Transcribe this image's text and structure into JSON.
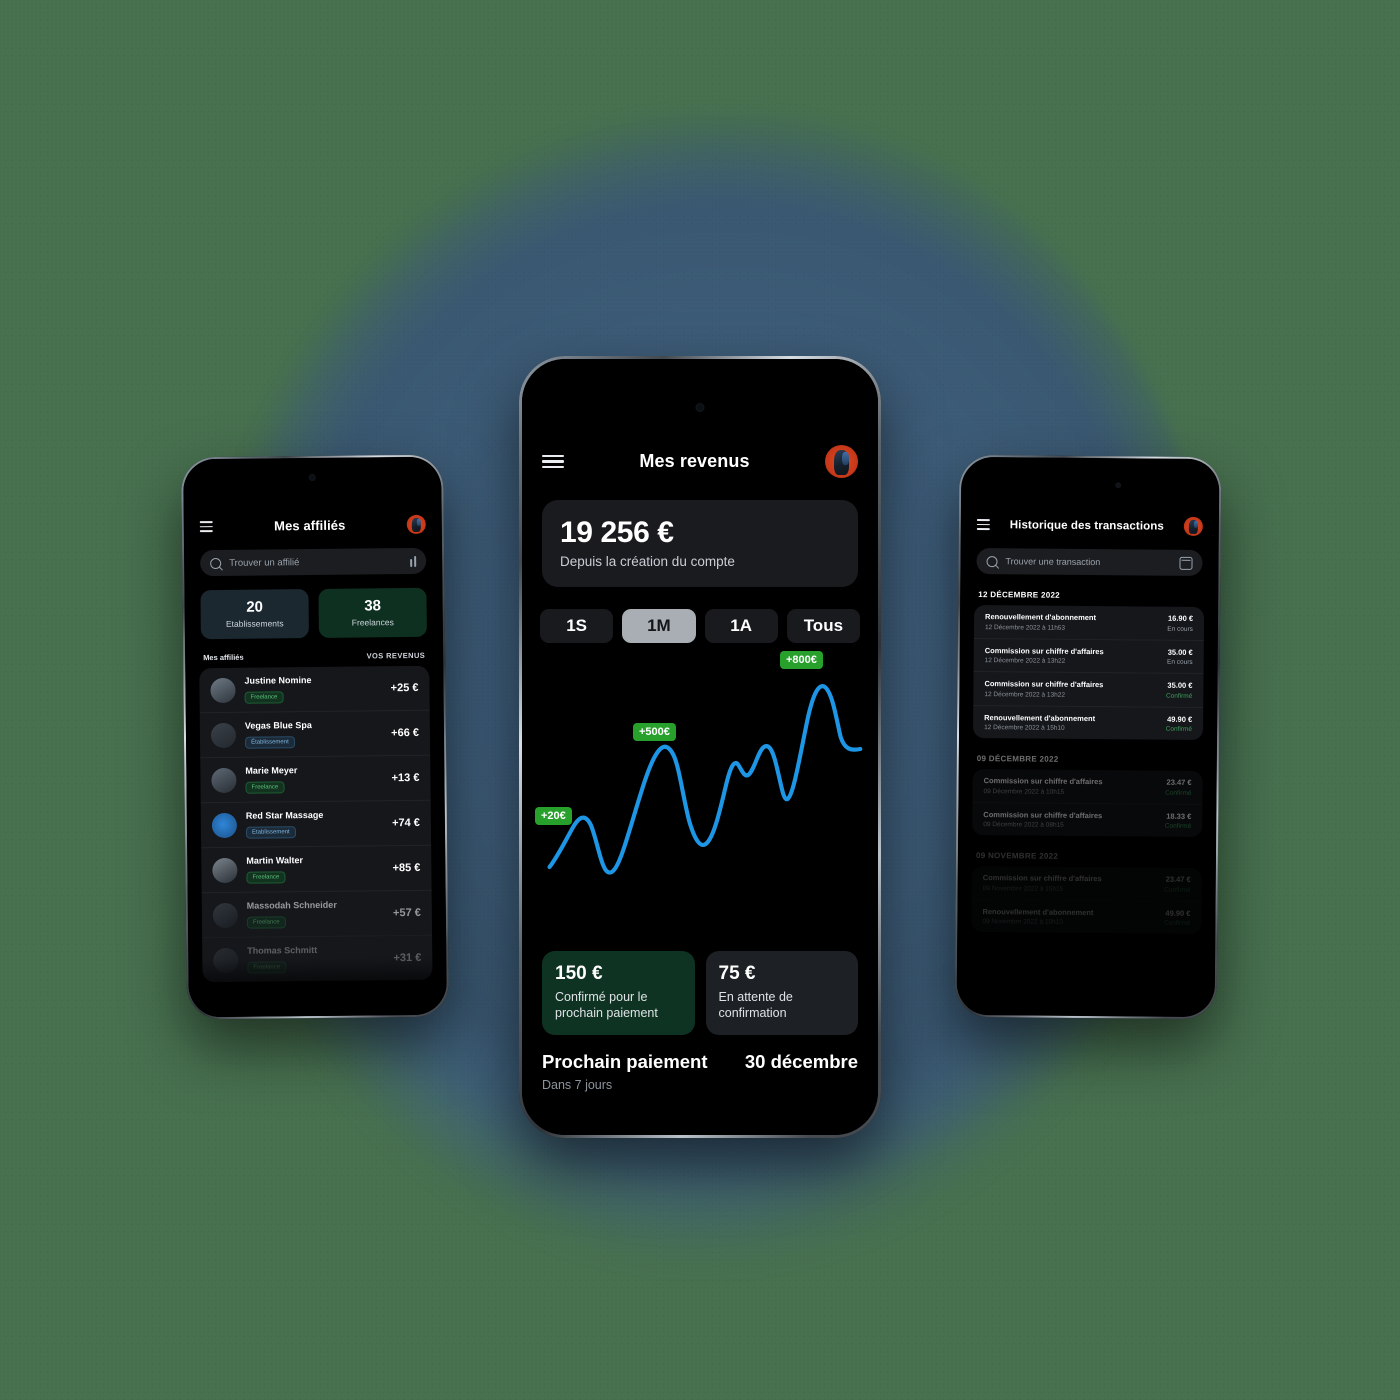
{
  "background": {
    "canvas_color": "#47704F",
    "blob_color": "#3E5E7B"
  },
  "accents": {
    "green": "#27A12C",
    "line_blue": "#1E96E6",
    "card_green": "#0F3322"
  },
  "phone_center": {
    "header": {
      "menu_icon": "hamburger-icon",
      "title": "Mes revenus",
      "avatar_icon": "user-avatar"
    },
    "balance": {
      "amount": "19 256 €",
      "caption": "Depuis la création du compte"
    },
    "segments": [
      {
        "label": "1S",
        "active": false
      },
      {
        "label": "1M",
        "active": true
      },
      {
        "label": "1A",
        "active": false
      },
      {
        "label": "Tous",
        "active": false
      }
    ],
    "chart_markers": [
      {
        "label": "+20€"
      },
      {
        "label": "+500€"
      },
      {
        "label": "+800€"
      }
    ],
    "mini_cards": [
      {
        "value": "150 €",
        "label": "Confirmé pour le prochain paiement",
        "tone": "green"
      },
      {
        "value": "75 €",
        "label": "En attente de confirmation",
        "tone": "grey"
      }
    ],
    "next_payment": {
      "label": "Prochain paiement",
      "date": "30 décembre",
      "note": "Dans 7 jours"
    }
  },
  "chart_data": {
    "type": "line",
    "title": "Mes revenus",
    "xlabel": "",
    "ylabel": "",
    "grid": false,
    "legend": "none",
    "series": [
      {
        "name": "Revenus",
        "color": "#1E96E6",
        "x": [
          0,
          4,
          9,
          14,
          20,
          26,
          32,
          38,
          44,
          50,
          56,
          62,
          68,
          74,
          80,
          86,
          92,
          100
        ],
        "values": [
          20,
          120,
          185,
          60,
          5,
          120,
          330,
          420,
          300,
          120,
          60,
          300,
          355,
          325,
          420,
          230,
          800,
          470
        ]
      }
    ],
    "annotations": [
      {
        "text": "+20€",
        "x": 2,
        "y": 120
      },
      {
        "text": "+500€",
        "x": 36,
        "y": 470
      },
      {
        "text": "+800€",
        "x": 90,
        "y": 880
      }
    ],
    "ylim": [
      0,
      900
    ],
    "xlim": [
      0,
      100
    ]
  },
  "phone_left": {
    "header": {
      "menu_icon": "hamburger-icon",
      "title": "Mes affiliés",
      "avatar_icon": "user-avatar"
    },
    "search": {
      "placeholder": "Trouver un affilié",
      "search_icon": "search-icon",
      "filter_icon": "filter-icon"
    },
    "stats": [
      {
        "number": "20",
        "caption": "Etablissements",
        "tone": "blue"
      },
      {
        "number": "38",
        "caption": "Freelances",
        "tone": "green"
      }
    ],
    "list_header": {
      "left": "Mes affiliés",
      "right": "VOS REVENUS"
    },
    "affiliates": [
      {
        "name": "Justine Nomine",
        "badge": "Freelance",
        "type": "free",
        "amount": "+25 €"
      },
      {
        "name": "Vegas Blue Spa",
        "badge": "Établissement",
        "type": "etab",
        "amount": "+66 €"
      },
      {
        "name": "Marie Meyer",
        "badge": "Freelance",
        "type": "free",
        "amount": "+13 €"
      },
      {
        "name": "Red Star Massage",
        "badge": "Etablissement",
        "type": "etab",
        "amount": "+74 €"
      },
      {
        "name": "Martin Walter",
        "badge": "Freelance",
        "type": "free",
        "amount": "+85 €"
      },
      {
        "name": "Massodah Schneider",
        "badge": "Freelance",
        "type": "free",
        "amount": "+57 €"
      },
      {
        "name": "Thomas Schmitt",
        "badge": "Freelance",
        "type": "free",
        "amount": "+31 €"
      }
    ]
  },
  "phone_right": {
    "header": {
      "menu_icon": "hamburger-icon",
      "title": "Historique des transactions",
      "avatar_icon": "user-avatar"
    },
    "search": {
      "placeholder": "Trouver une transaction",
      "search_icon": "search-icon",
      "calendar_icon": "calendar-icon"
    },
    "groups": [
      {
        "date": "12 DÉCEMBRE 2022",
        "opacity": "full",
        "rows": [
          {
            "name": "Renouvellement d'abonnement",
            "date": "12 Décembre 2022 à 11h53",
            "amount": "16.90 €",
            "status": "En cours",
            "status_type": "pending"
          },
          {
            "name": "Commission sur chiffre d'affaires",
            "date": "12 Décembre 2022 à 13h22",
            "amount": "35.00 €",
            "status": "En cours",
            "status_type": "pending"
          },
          {
            "name": "Commission sur chiffre d'affaires",
            "date": "12 Décembre 2022 à 13h22",
            "amount": "35.00 €",
            "status": "Confirmé",
            "status_type": "ok"
          },
          {
            "name": "Renouvellement d'abonnement",
            "date": "12 Décembre 2022 à 15h10",
            "amount": "49.90 €",
            "status": "Confirmé",
            "status_type": "ok"
          }
        ]
      },
      {
        "date": "09 DÉCEMBRE 2022",
        "opacity": "dim",
        "rows": [
          {
            "name": "Commission sur chiffre d'affaires",
            "date": "09 Décembre 2022 à 10h15",
            "amount": "23.47 €",
            "status": "Confirmé",
            "status_type": "ok"
          },
          {
            "name": "Commission sur chiffre d'affaires",
            "date": "09 Décembre 2022 à 08h15",
            "amount": "18.33 €",
            "status": "Confirmé",
            "status_type": "ok"
          }
        ]
      },
      {
        "date": "09 NOVEMBRE 2022",
        "opacity": "dim2",
        "rows": [
          {
            "name": "Commission sur chiffre d'affaires",
            "date": "09 Novembre 2022 à 15h15",
            "amount": "23.47 €",
            "status": "Confirmé",
            "status_type": "ok"
          },
          {
            "name": "Renouvellement d'abonnement",
            "date": "09 Novembre 2022 à 10h10",
            "amount": "49.90 €",
            "status": "Confirmé",
            "status_type": "ok"
          }
        ]
      }
    ]
  }
}
